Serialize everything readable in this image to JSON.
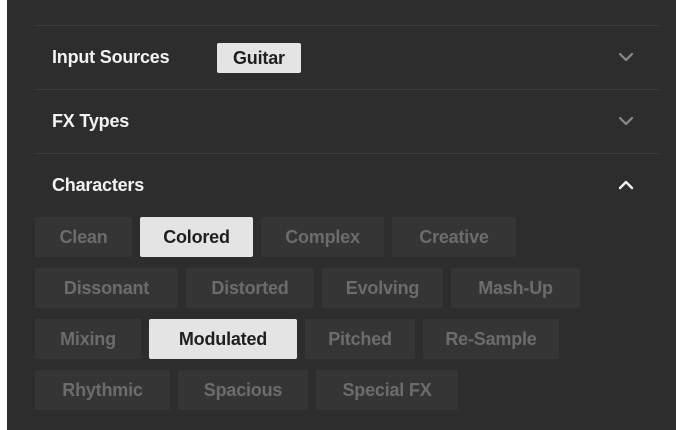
{
  "sections": [
    {
      "title": "Input Sources",
      "badge": "Guitar",
      "expanded": false
    },
    {
      "title": "FX Types",
      "expanded": false
    },
    {
      "title": "Characters",
      "expanded": true
    }
  ],
  "characters": {
    "rows": [
      [
        {
          "label": "Clean",
          "selected": false
        },
        {
          "label": "Colored",
          "selected": true
        },
        {
          "label": "Complex",
          "selected": false
        },
        {
          "label": "Creative",
          "selected": false
        }
      ],
      [
        {
          "label": "Dissonant",
          "selected": false
        },
        {
          "label": "Distorted",
          "selected": false
        },
        {
          "label": "Evolving",
          "selected": false
        },
        {
          "label": "Mash-Up",
          "selected": false
        }
      ],
      [
        {
          "label": "Mixing",
          "selected": false
        },
        {
          "label": "Modulated",
          "selected": true
        },
        {
          "label": "Pitched",
          "selected": false
        },
        {
          "label": "Re-Sample",
          "selected": false
        }
      ],
      [
        {
          "label": "Rhythmic",
          "selected": false
        },
        {
          "label": "Spacious",
          "selected": false
        },
        {
          "label": "Special FX",
          "selected": false
        }
      ]
    ]
  },
  "icons": {
    "collapsed": "chevron-down-icon",
    "expanded": "chevron-up-icon"
  },
  "colors": {
    "panel_bg": "#2d2d2d",
    "tag_off_bg": "#353535",
    "tag_off_text": "#6c6c6c",
    "tag_on_bg": "#e4e4e4",
    "tag_on_text": "#1f1f1f"
  }
}
